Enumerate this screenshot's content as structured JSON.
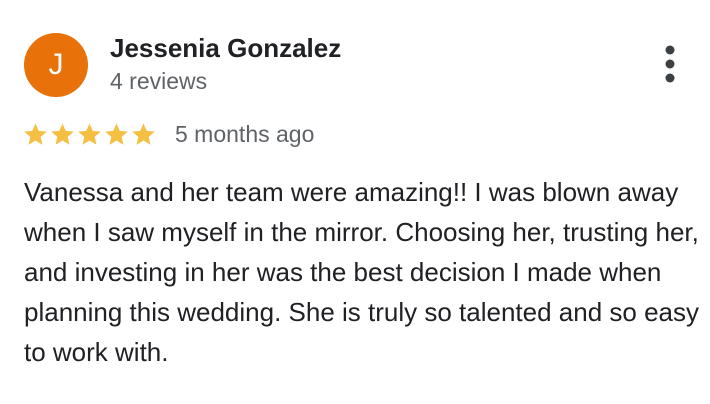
{
  "reviewer": {
    "initial": "J",
    "name": "Jessenia Gonzalez",
    "review_count": "4 reviews",
    "avatar_color": "#e8710a"
  },
  "rating": {
    "stars": 5,
    "max_stars": 5,
    "star_color": "#f4bf42",
    "date": "5 months ago"
  },
  "review": {
    "text": "Vanessa and her team were amazing!! I was blown away when I saw myself in the mirror. Choosing her, trusting her, and investing in her was the best decision I made when planning this wedding. She is truly so talented and so easy to work with."
  },
  "icons": {
    "more": "more-vert-icon",
    "star": "star-icon"
  }
}
